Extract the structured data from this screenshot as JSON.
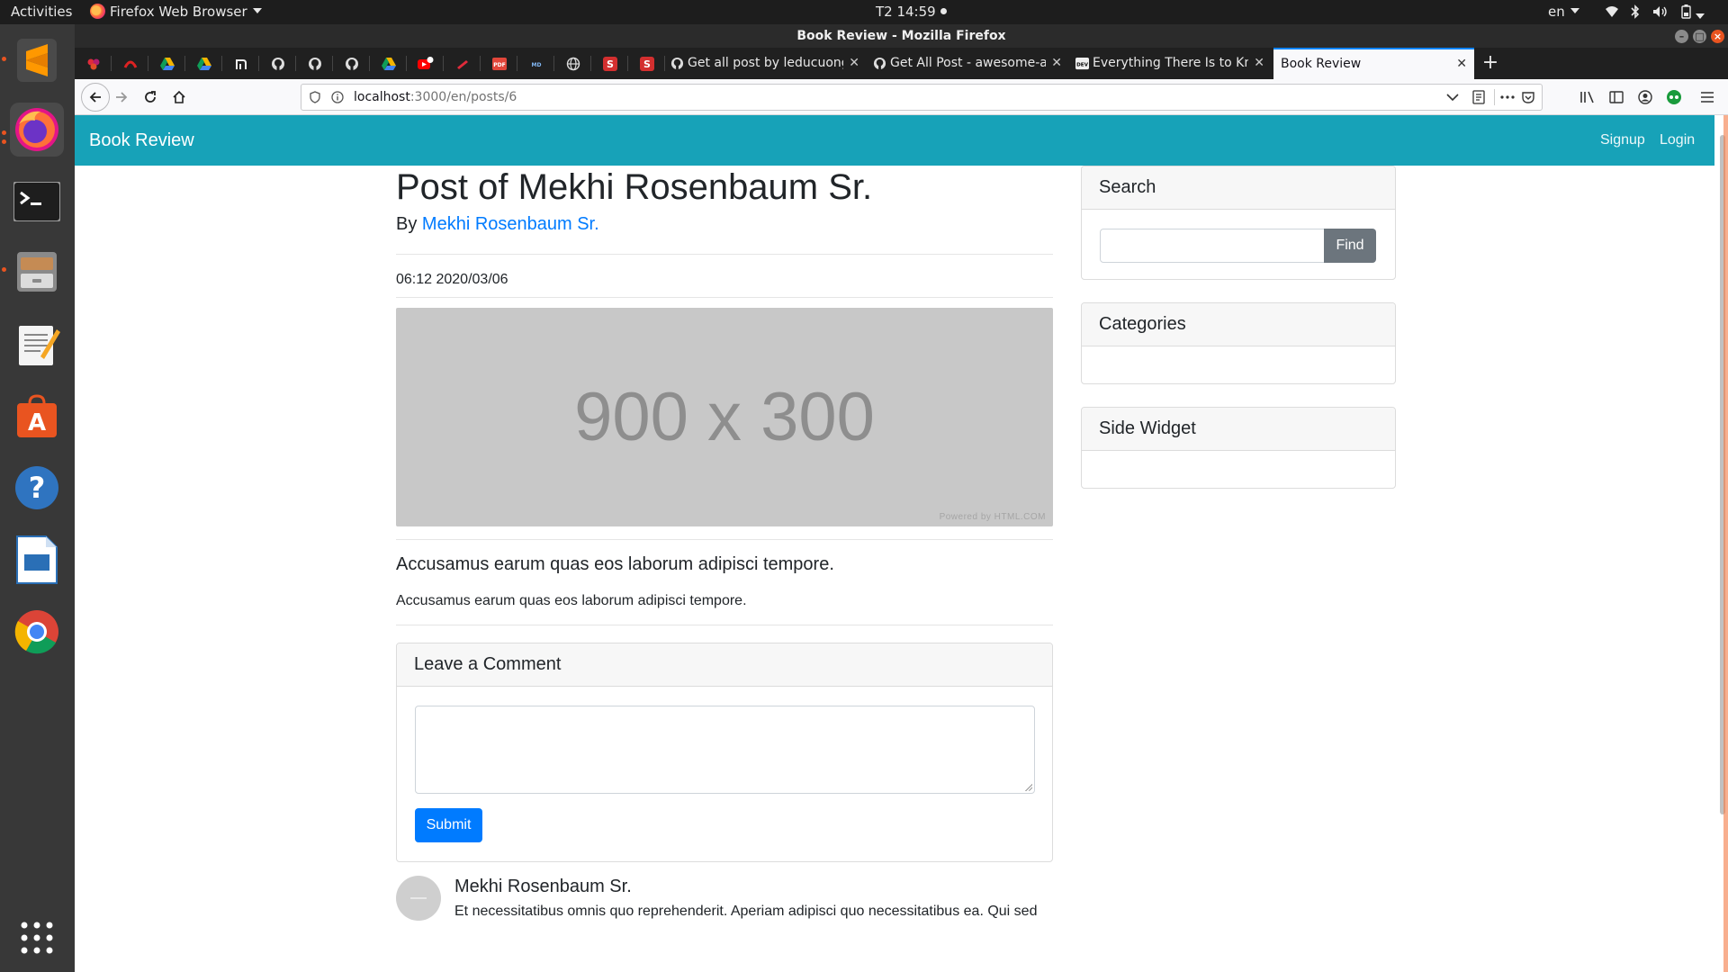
{
  "system": {
    "activities_label": "Activities",
    "app_menu_label": "Firefox Web Browser",
    "clock": "T2 14:59",
    "language": "en"
  },
  "window": {
    "title": "Book Review - Mozilla Firefox"
  },
  "dock": {
    "items": [
      "sublime-text",
      "firefox",
      "terminal",
      "files",
      "text-editor",
      "software-center",
      "help",
      "writer",
      "chrome",
      "show-applications"
    ]
  },
  "browser": {
    "tabs": [
      {
        "label": "Get all post by leducuong",
        "favicon": "github-icon"
      },
      {
        "label": "Get All Post - awesome-a",
        "favicon": "github-icon"
      },
      {
        "label": "Everything There Is to Kn",
        "favicon": "dev-icon"
      },
      {
        "label": "Book Review",
        "active": true
      }
    ],
    "url_host": "localhost",
    "url_path": ":3000/en/posts/6"
  },
  "site": {
    "brand": "Book Review",
    "nav": {
      "signup": "Signup",
      "login": "Login"
    },
    "accent_color": "#17a2b8"
  },
  "post": {
    "title": "Post of Mekhi Rosenbaum Sr.",
    "by_prefix": "By",
    "author": "Mekhi Rosenbaum Sr.",
    "date": "06:12 2020/03/06",
    "image_placeholder": "900 x 300",
    "image_powered_by": "Powered by HTML.COM",
    "lead": "Accusamus earum quas eos laborum adipisci tempore.",
    "body": "Accusamus earum quas eos laborum adipisci tempore."
  },
  "comment_form": {
    "header": "Leave a Comment",
    "textarea_value": "",
    "submit_label": "Submit"
  },
  "comments": [
    {
      "author": "Mekhi Rosenbaum Sr.",
      "text": "Et necessitatibus omnis quo reprehenderit. Aperiam adipisci quo necessitatibus ea. Qui sed"
    }
  ],
  "sidebar": {
    "search_header": "Search",
    "search_value": "",
    "find_label": "Find",
    "categories_header": "Categories",
    "side_widget_header": "Side Widget"
  }
}
